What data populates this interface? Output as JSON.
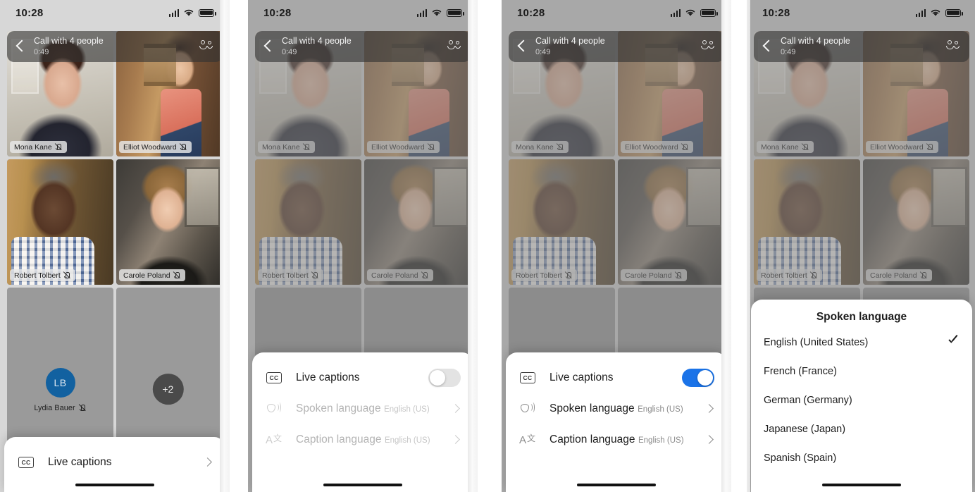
{
  "status_bar": {
    "time": "10:28",
    "icons": [
      "cellular-signal-icon",
      "wifi-icon",
      "battery-icon"
    ]
  },
  "call_header": {
    "back_icon": "chevron-left-icon",
    "title": "Call with 4 people",
    "duration": "0:49",
    "participants_icon": "people-icon"
  },
  "participants": [
    {
      "name": "Mona Kane",
      "muted": true,
      "tile": "video"
    },
    {
      "name": "Elliot Woodward",
      "muted": true,
      "tile": "video"
    },
    {
      "name": "Robert Tolbert",
      "muted": true,
      "tile": "video"
    },
    {
      "name": "Carole Poland",
      "muted": true,
      "tile": "video"
    },
    {
      "name": "Lydia Bauer",
      "muted": true,
      "tile": "avatar",
      "initials": "LB"
    }
  ],
  "overflow_badge": "+2",
  "self_view": {
    "flip_camera_icon": "flip-camera-icon"
  },
  "panels": [
    {
      "id": "panel-collapsed",
      "sheet_type": "collapsed",
      "rows": [
        {
          "icon": "cc-icon",
          "label": "Live captions",
          "accessory": "chevron-right-icon"
        }
      ]
    },
    {
      "id": "panel-captions-off",
      "sheet_type": "settings",
      "rows": [
        {
          "icon": "cc-icon",
          "label": "Live captions",
          "accessory": "toggle",
          "toggle_on": false,
          "disabled": false
        },
        {
          "icon": "spoken-language-icon",
          "label": "Spoken language",
          "value": "English (US)",
          "accessory": "chevron-right-icon",
          "disabled": true
        },
        {
          "icon": "caption-language-icon",
          "label": "Caption language",
          "value": "English (US)",
          "accessory": "chevron-right-icon",
          "disabled": true
        }
      ]
    },
    {
      "id": "panel-captions-on",
      "sheet_type": "settings",
      "rows": [
        {
          "icon": "cc-icon",
          "label": "Live captions",
          "accessory": "toggle",
          "toggle_on": true,
          "disabled": false
        },
        {
          "icon": "spoken-language-icon",
          "label": "Spoken language",
          "value": "English (US)",
          "accessory": "chevron-right-icon",
          "disabled": false
        },
        {
          "icon": "caption-language-icon",
          "label": "Caption language",
          "value": "English (US)",
          "accessory": "chevron-right-icon",
          "disabled": false
        }
      ]
    },
    {
      "id": "panel-language-picker",
      "sheet_type": "language-list",
      "title": "Spoken language",
      "options": [
        {
          "label": "English (United States)",
          "selected": true
        },
        {
          "label": "French (France)",
          "selected": false
        },
        {
          "label": "German (Germany)",
          "selected": false
        },
        {
          "label": "Japanese (Japan)",
          "selected": false
        },
        {
          "label": "Spanish (Spain)",
          "selected": false
        }
      ]
    }
  ],
  "colors": {
    "toggle_on": "#1a73e8",
    "toggle_off": "#e3e3e3",
    "avatar": "#1261a0",
    "hangup": "#8e1b2e",
    "sheet_bg": "#ffffff"
  }
}
